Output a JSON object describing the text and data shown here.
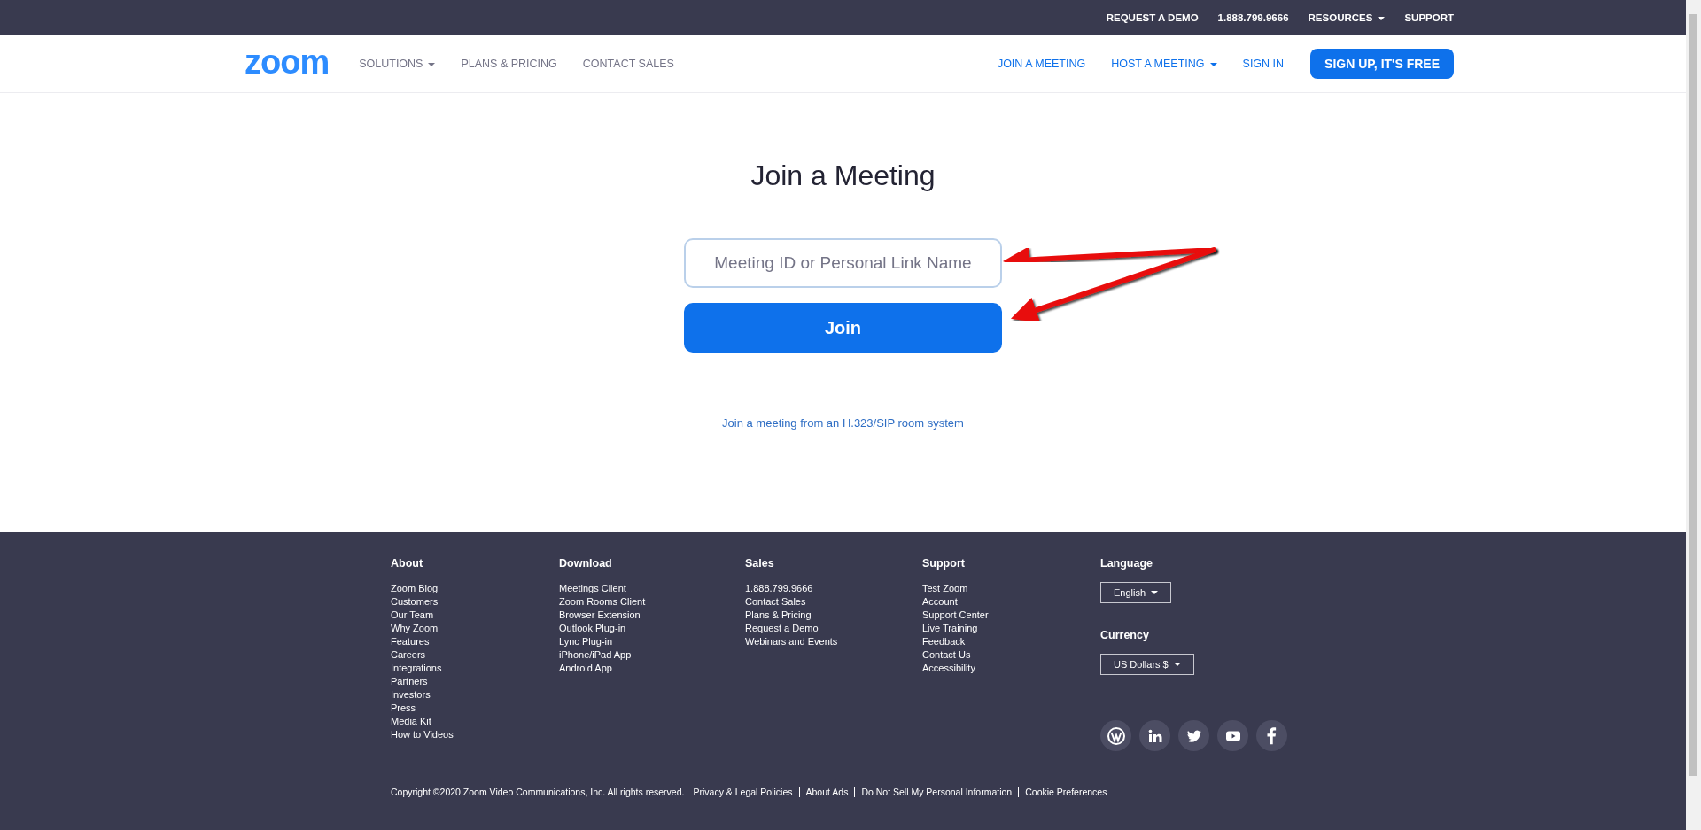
{
  "top_bar": {
    "links": [
      {
        "label": "REQUEST A DEMO",
        "dropdown": false
      },
      {
        "label": "1.888.799.9666",
        "dropdown": false
      },
      {
        "label": "RESOURCES",
        "dropdown": true
      },
      {
        "label": "SUPPORT",
        "dropdown": false
      }
    ]
  },
  "nav": {
    "logo": "zoom",
    "left_links": [
      {
        "label": "SOLUTIONS",
        "dropdown": true
      },
      {
        "label": "PLANS & PRICING",
        "dropdown": false
      },
      {
        "label": "CONTACT SALES",
        "dropdown": false
      }
    ],
    "right_links": [
      {
        "label": "JOIN A MEETING",
        "dropdown": false
      },
      {
        "label": "HOST A MEETING",
        "dropdown": true
      },
      {
        "label": "SIGN IN",
        "dropdown": false
      }
    ],
    "signup_button": "SIGN UP, IT'S FREE"
  },
  "join": {
    "title": "Join a Meeting",
    "placeholder": "Meeting ID or Personal Link Name",
    "button": "Join",
    "room_link": "Join a meeting from an H.323/SIP room system"
  },
  "footer": {
    "columns": [
      {
        "heading": "About",
        "links": [
          "Zoom Blog",
          "Customers",
          "Our Team",
          "Why Zoom",
          "Features",
          "Careers",
          "Integrations",
          "Partners",
          "Investors",
          "Press",
          "Media Kit",
          "How to Videos"
        ]
      },
      {
        "heading": "Download",
        "links": [
          "Meetings Client",
          "Zoom Rooms Client",
          "Browser Extension",
          "Outlook Plug-in",
          "Lync Plug-in",
          "iPhone/iPad App",
          "Android App"
        ]
      },
      {
        "heading": "Sales",
        "links": [
          "1.888.799.9666",
          "Contact Sales",
          "Plans & Pricing",
          "Request a Demo",
          "Webinars and Events"
        ]
      },
      {
        "heading": "Support",
        "links": [
          "Test Zoom",
          "Account",
          "Support Center",
          "Live Training",
          "Feedback",
          "Contact Us",
          "Accessibility"
        ]
      }
    ],
    "language": {
      "heading": "Language",
      "value": "English"
    },
    "currency": {
      "heading": "Currency",
      "value": "US Dollars $"
    },
    "copyright": "Copyright ©2020 Zoom Video Communications, Inc. All rights reserved.",
    "legal_links": [
      "Privacy & Legal Policies",
      "About Ads",
      "Do Not Sell My Personal Information",
      "Cookie Preferences"
    ]
  }
}
